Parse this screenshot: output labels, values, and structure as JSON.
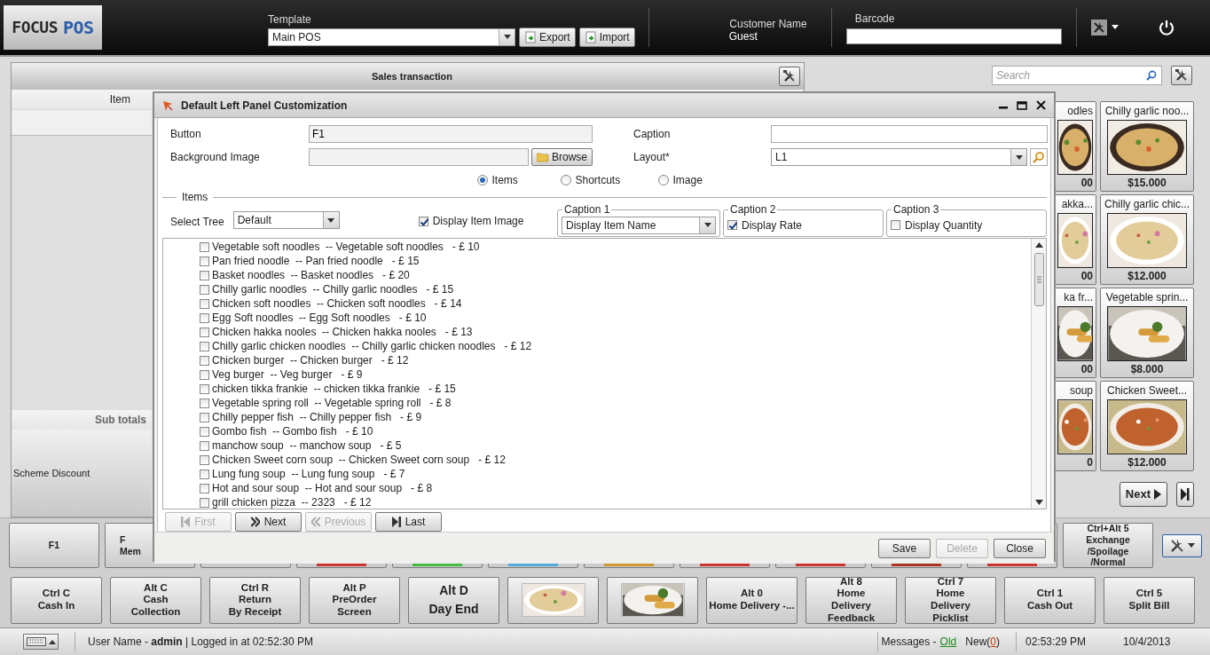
{
  "top_bar": {
    "logo": {
      "word_1": "FOCUS",
      "word_2": "POS"
    },
    "template": {
      "label": "Template",
      "value": "Main POS"
    },
    "template_buttons": [
      {
        "label": "Export"
      },
      {
        "label": "Import"
      }
    ],
    "customer": {
      "label": "Customer Name",
      "value": "Guest"
    },
    "barcode": {
      "label": "Barcode"
    }
  },
  "sales_panel": {
    "title": "Sales transaction",
    "columns": [
      "Item"
    ],
    "subtotals_label": "Sub totals",
    "scheme_discount_label": "Scheme Discount"
  },
  "products": {
    "search_placeholder": "Search",
    "next_label": "Next",
    "tiles": [
      {
        "kind": "partial",
        "name": "odles",
        "price": "00"
      },
      {
        "kind": "full",
        "name": "Chilly garlic noo...",
        "price": "$15.000"
      },
      {
        "kind": "partial",
        "name": "akka...",
        "price": "00"
      },
      {
        "kind": "full",
        "name": "Chilly garlic chic...",
        "price": "$12.000"
      },
      {
        "kind": "partial",
        "name": "ka fr...",
        "price": "00"
      },
      {
        "kind": "full",
        "name": "Vegetable sprin...",
        "price": "$8.000"
      },
      {
        "kind": "partial",
        "name": "soup",
        "price": "0"
      },
      {
        "kind": "full",
        "name": "Chicken Sweet...",
        "price": "$12.000"
      }
    ]
  },
  "function_row_1": [
    {
      "kind": "text",
      "lines": [
        "F1"
      ]
    },
    {
      "kind": "text",
      "lines": [
        "F",
        "Mem"
      ]
    },
    {
      "kind": "covered"
    },
    {
      "kind": "covered",
      "color": "#cc3333"
    },
    {
      "kind": "covered",
      "color": "#44bb44"
    },
    {
      "kind": "covered",
      "color": "#55aadd"
    },
    {
      "kind": "covered",
      "color": "#cc9933"
    },
    {
      "kind": "covered",
      "color": "#cc3333"
    },
    {
      "kind": "covered",
      "color": "#cc3333"
    },
    {
      "kind": "covered",
      "color": "#aa3322"
    },
    {
      "kind": "covered",
      "color": "#cc3333"
    },
    {
      "kind": "text",
      "lines": [
        "Ctrl+Alt 5",
        "Exchange",
        "/Spoilage",
        "/Normal"
      ]
    }
  ],
  "function_row_2": [
    {
      "kind": "text",
      "lines": [
        "Ctrl C",
        "Cash In"
      ]
    },
    {
      "kind": "text",
      "lines": [
        "Alt C",
        "Cash",
        "Collection"
      ]
    },
    {
      "kind": "text",
      "lines": [
        "Ctrl R",
        "Return",
        "By Receipt"
      ]
    },
    {
      "kind": "text",
      "lines": [
        "Alt P",
        "PreOrder",
        "Screen"
      ]
    },
    {
      "kind": "large",
      "lines": [
        "Alt D",
        "Day End"
      ]
    },
    {
      "kind": "picture"
    },
    {
      "kind": "picture"
    },
    {
      "kind": "text",
      "lines": [
        "Alt 0",
        "Home Delivery -..."
      ]
    },
    {
      "kind": "text",
      "lines": [
        "Alt 8",
        "Home",
        "Delivery",
        "Feedback"
      ]
    },
    {
      "kind": "text",
      "lines": [
        "Ctrl 7",
        "Home",
        "Delivery",
        "Picklist"
      ]
    },
    {
      "kind": "text",
      "lines": [
        "Ctrl 1",
        "Cash Out"
      ]
    },
    {
      "kind": "text",
      "lines": [
        "Ctrl 5",
        "Split Bill"
      ]
    }
  ],
  "status_bar": {
    "user_info": "User Name - **admin** | Logged in at 02:52:30 PM",
    "messages_label": "Messages -",
    "old_link": "Old",
    "new_messages": {
      "prefix": "New(",
      "count": "0",
      "suffix": ")"
    },
    "time": "02:53:29 PM",
    "date": "10/4/2013"
  },
  "dialog": {
    "title": "Default Left Panel Customization",
    "fields": [
      {
        "kind": "text",
        "label": "Button",
        "value": "F1"
      },
      {
        "kind": "text",
        "label": "Caption"
      },
      {
        "kind": "browse",
        "label": "Background Image",
        "button": "Browse"
      },
      {
        "kind": "dropdown",
        "label": "Layout*",
        "value": "L1"
      }
    ],
    "modes": [
      {
        "label": "Items",
        "selected": true
      },
      {
        "label": "Shortcuts",
        "selected": false
      },
      {
        "label": "Image",
        "selected": false
      }
    ],
    "group_title": "Items",
    "select_tree": {
      "label": "Select Tree",
      "value": "Default"
    },
    "display_item_image": {
      "label": "Display Item Image",
      "checked": true
    },
    "caption_groups": [
      {
        "kind": "dropdown",
        "title": "Caption 1",
        "value": "Display Item Name"
      },
      {
        "kind": "checkbox",
        "title": "Caption 2",
        "label": "Display Rate",
        "checked": true
      },
      {
        "kind": "checkbox",
        "title": "Caption 3",
        "label": "Display Quantity",
        "checked": false
      }
    ],
    "items": [
      {
        "text": "Vegetable soft noodles  -- Vegetable soft noodles   - £ 10",
        "checked": false
      },
      {
        "text": "Pan fried noodle  -- Pan fried noodle   - £ 15",
        "checked": false
      },
      {
        "text": "Basket noodles  -- Basket noodles   - £ 20",
        "checked": false
      },
      {
        "text": "Chilly garlic noodles  -- Chilly garlic noodles   - £ 15",
        "checked": false
      },
      {
        "text": "Chicken soft noodles  -- Chicken soft noodles   - £ 14",
        "checked": false
      },
      {
        "text": "Egg Soft noodles  -- Egg Soft noodles   - £ 10",
        "checked": false
      },
      {
        "text": "Chicken hakka nooles  -- Chicken hakka nooles   - £ 13",
        "checked": false
      },
      {
        "text": "Chilly garlic chicken noodles  -- Chilly garlic chicken noodles   - £ 12",
        "checked": false
      },
      {
        "text": "Chicken burger  -- Chicken burger   - £ 12",
        "checked": false
      },
      {
        "text": "Veg burger  -- Veg burger   - £ 9",
        "checked": false
      },
      {
        "text": "chicken tikka frankie  -- chicken tikka frankie   - £ 15",
        "checked": false
      },
      {
        "text": "Vegetable spring roll  -- Vegetable spring roll   - £ 8",
        "checked": false
      },
      {
        "text": "Chilly pepper fish  -- Chilly pepper fish   - £ 9",
        "checked": false
      },
      {
        "text": "Gombo fish  -- Gombo fish   - £ 10",
        "checked": false
      },
      {
        "text": "manchow soup  -- manchow soup   - £ 5",
        "checked": false
      },
      {
        "text": "Chicken Sweet corn soup  -- Chicken Sweet corn soup   - £ 12",
        "checked": false
      },
      {
        "text": "Lung fung soup  -- Lung fung soup   - £ 7",
        "checked": false
      },
      {
        "text": "Hot and sour soup  -- Hot and sour soup   - £ 8",
        "checked": false
      },
      {
        "text": "grill chicken pizza  -- 2323   - £ 12",
        "checked": false
      }
    ],
    "pager": [
      {
        "kind": "first",
        "label": "First",
        "disabled": true
      },
      {
        "kind": "next",
        "label": "Next",
        "disabled": false
      },
      {
        "kind": "previous",
        "label": "Previous",
        "disabled": true
      },
      {
        "kind": "last",
        "label": "Last",
        "disabled": false
      }
    ],
    "footer_buttons": [
      {
        "label": "Save",
        "disabled": false
      },
      {
        "label": "Delete",
        "disabled": true
      },
      {
        "label": "Close",
        "disabled": false
      }
    ]
  }
}
